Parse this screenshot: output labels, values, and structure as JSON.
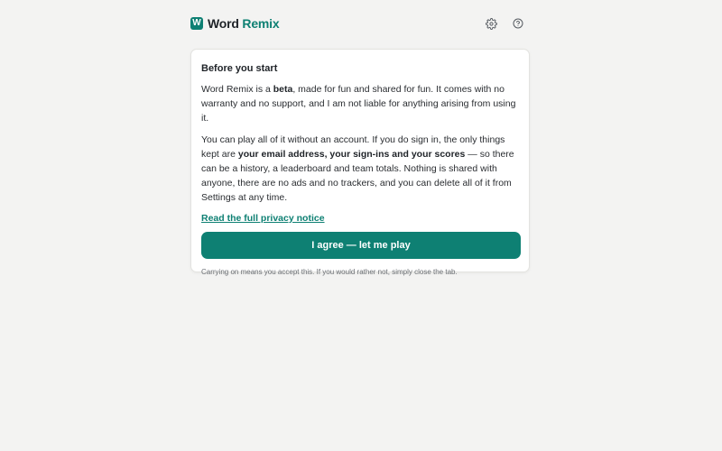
{
  "header": {
    "logo_letter": "W",
    "brand_word1": "Word",
    "brand_word2": "Remix",
    "settings_icon": "gear-icon",
    "help_icon": "help-circle-icon"
  },
  "notice": {
    "title": "Before you start",
    "p1_a": "Word Remix is a ",
    "p1_bold": "beta",
    "p1_b": ", made for fun and shared for fun. It comes with no warranty and no support, and I am not liable for anything arising from using it.",
    "p2_a": "You can play all of it without an account. If you do sign in, the only things kept are ",
    "p2_bold": "your email address, your sign-ins and your scores",
    "p2_b": " — so there can be a history, a leaderboard and team totals. Nothing is shared with anyone, there are no ads and no trackers, and you can delete all of it from Settings at any time.",
    "privacy_link": "Read the full privacy notice",
    "agree_button": "I agree — let me play",
    "footnote": "Carrying on means you accept this. If you would rather not, simply close the tab."
  },
  "colors": {
    "accent": "#0e8073",
    "background": "#f3f3f2",
    "card": "#ffffff"
  }
}
